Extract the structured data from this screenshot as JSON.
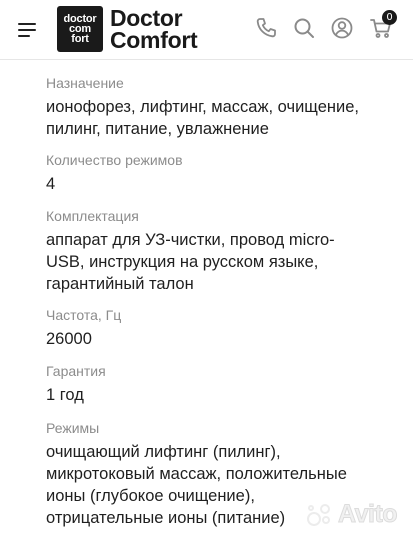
{
  "header": {
    "logo_mark": [
      "doctor",
      "com",
      "fort"
    ],
    "logo_text": [
      "Doctor",
      "Comfort"
    ],
    "cart_count": "0",
    "icons": [
      "menu-icon",
      "phone-icon",
      "search-icon",
      "user-icon",
      "cart-icon"
    ]
  },
  "specs": [
    {
      "label": "Назначение",
      "value": [
        "ионофорез, лифтинг, массаж, очищение,",
        "пилинг, питание, увлажнение"
      ]
    },
    {
      "label": "Количество режимов",
      "value": [
        "4"
      ]
    },
    {
      "label": "Комплектация",
      "value": [
        "аппарат для УЗ-чистки, провод micro-",
        "USB, инструкция на русском языке,",
        "гарантийный талон"
      ]
    },
    {
      "label": "Частота, Гц",
      "value": [
        "26000"
      ]
    },
    {
      "label": "Гарантия",
      "value": [
        "1 год"
      ]
    },
    {
      "label": "Режимы",
      "value": [
        "очищающий лифтинг (пилинг),",
        "микротоковый массаж, положительные",
        "ионы (глубокое очищение),",
        "отрицательные ионы (питание)"
      ]
    }
  ],
  "watermark": {
    "text": "Avito"
  }
}
